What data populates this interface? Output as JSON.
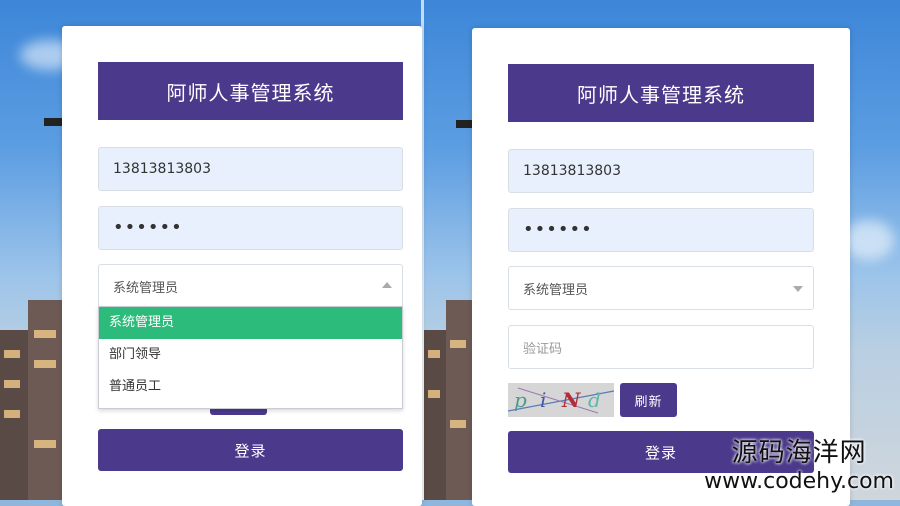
{
  "left_panel": {
    "title": "阿师人事管理系统",
    "phone_value": "13813813803",
    "password_value": "••••••",
    "role_select": {
      "value": "系统管理员",
      "state": "open",
      "options": [
        "系统管理员",
        "部门领导",
        "普通员工"
      ],
      "highlighted_index": 0
    },
    "login_label": "登录"
  },
  "right_panel": {
    "title": "阿师人事管理系统",
    "phone_value": "13813813803",
    "password_value": "••••••",
    "role_select": {
      "value": "系统管理员",
      "state": "closed"
    },
    "captcha_input": {
      "value": "",
      "placeholder": "验证码"
    },
    "captcha_image_text": [
      "p",
      "i",
      "N",
      "d"
    ],
    "refresh_label": "刷新",
    "login_label": "登录"
  },
  "watermark": {
    "line1": "源码海洋网",
    "line2": "www.codehy.com"
  },
  "colors": {
    "brand_purple": "#4b3a8c",
    "selected_green": "#2dbb7b",
    "autofill_blue": "#e8f0fd"
  }
}
